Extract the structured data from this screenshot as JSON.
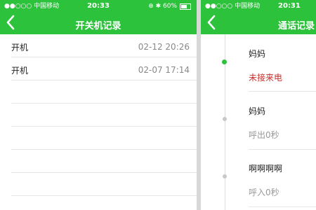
{
  "left": {
    "status": {
      "carrier": "●●○○○ 中国移动 ",
      "time": "20:33",
      "right": "⊕ ✱ 60%"
    },
    "title": "开关机记录",
    "records": [
      {
        "label": "开机",
        "time": "02-12 20:26"
      },
      {
        "label": "开机",
        "time": "02-07 17:14"
      }
    ]
  },
  "right": {
    "status": {
      "carrier": "●●○○○ 中国移动 ",
      "time": "20:31"
    },
    "title": "通话记录",
    "calls": [
      {
        "name": "妈妈",
        "status": "未接来电",
        "missed": true
      },
      {
        "name": "妈妈",
        "status": "呼出0秒",
        "missed": false
      },
      {
        "name": "啊啊啊啊",
        "status": "呼入0秒",
        "missed": false
      }
    ]
  },
  "colors": {
    "header": "#2dc23c",
    "missed": "#c9302c"
  }
}
